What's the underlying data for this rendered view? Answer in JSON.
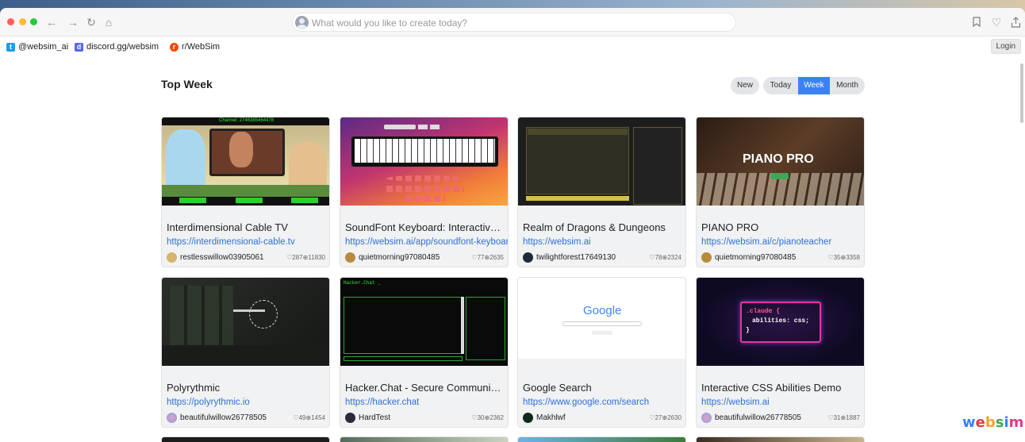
{
  "browser": {
    "search_placeholder": "What would you like to create today?"
  },
  "social_links": [
    {
      "label": "@websim_ai",
      "icon": "twitter-icon"
    },
    {
      "label": "discord.gg/websim",
      "icon": "discord-icon"
    },
    {
      "label": "r/WebSim",
      "icon": "reddit-icon"
    }
  ],
  "login_label": "Login",
  "section": {
    "title": "Top Week"
  },
  "filters": {
    "new": "New",
    "today": "Today",
    "week": "Week",
    "month": "Month",
    "active": "Week"
  },
  "cards": [
    {
      "title": "Interdimensional Cable TV",
      "url": "https://interdimensional-cable.tv",
      "user": "restlesswillow03905061",
      "likes": "287",
      "views": "11830"
    },
    {
      "title": "SoundFont Keyboard: Interactive ...",
      "url": "https://websim.ai/app/soundfont-keyboard",
      "user": "quietmorning97080485",
      "likes": "77",
      "views": "2635"
    },
    {
      "title": "Realm of Dragons & Dungeons",
      "url": "https://websim.ai",
      "user": "twilightforest17649130",
      "likes": "78",
      "views": "2324"
    },
    {
      "title": "PIANO PRO",
      "url": "https://websim.ai/c/pianoteacher",
      "user": "quietmorning97080485",
      "likes": "35",
      "views": "3358"
    },
    {
      "title": "Polyrythmic",
      "url": "https://polyrythmic.io",
      "user": "beautifulwillow26778505",
      "likes": "49",
      "views": "1454"
    },
    {
      "title": "Hacker.Chat - Secure Communicat...",
      "url": "https://hacker.chat",
      "user": "HardTest",
      "likes": "30",
      "views": "2362"
    },
    {
      "title": "Google Search",
      "url": "https://www.google.com/search",
      "user": "Makhlwf",
      "likes": "27",
      "views": "2630"
    },
    {
      "title": "Interactive CSS Abilities Demo",
      "url": "https://websim.ai",
      "user": "beautifulwillow26778505",
      "likes": "31",
      "views": "1887"
    }
  ],
  "thumb_text": {
    "cable_channel": "Channel: 2746385464478",
    "piano_pro": "PIANO PRO",
    "hacker_chat": "Hacker.Chat _",
    "google": "Google",
    "claude_line1": ".claude {",
    "claude_line2": "abilities: css;",
    "claude_line3": "}"
  },
  "logo_text": "websim"
}
